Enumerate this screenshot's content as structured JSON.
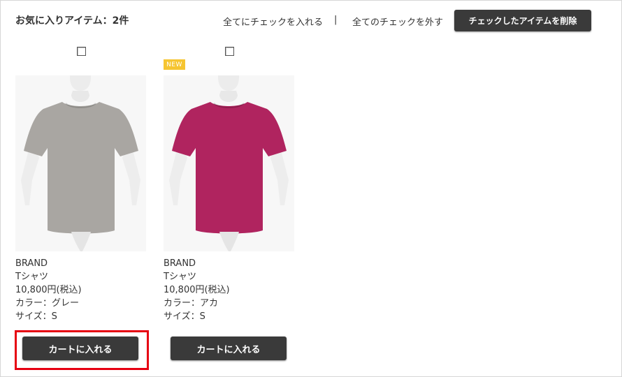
{
  "header": {
    "title": "お気に入りアイテム：2件",
    "check_all": "全てにチェックを入れる",
    "separator": "|",
    "uncheck_all": "全てのチェックを外す",
    "delete_checked": "チェックしたアイテムを削除"
  },
  "items": [
    {
      "badge": "",
      "brand": "BRAND",
      "name": "Tシャツ",
      "price": "10,800円(税込)",
      "color": "カラー：グレー",
      "size": "サイズ：S",
      "cart_label": "カートに入れる",
      "shirt_color": "#a9a6a2"
    },
    {
      "badge": "NEW",
      "brand": "BRAND",
      "name": "Tシャツ",
      "price": "10,800円(税込)",
      "color": "カラー：アカ",
      "size": "サイズ：S",
      "cart_label": "カートに入れる",
      "shirt_color": "#b0245f"
    }
  ],
  "colors": {
    "button_bg": "#3a3a3a",
    "highlight_border": "#e60012",
    "new_badge": "#f6c531"
  }
}
